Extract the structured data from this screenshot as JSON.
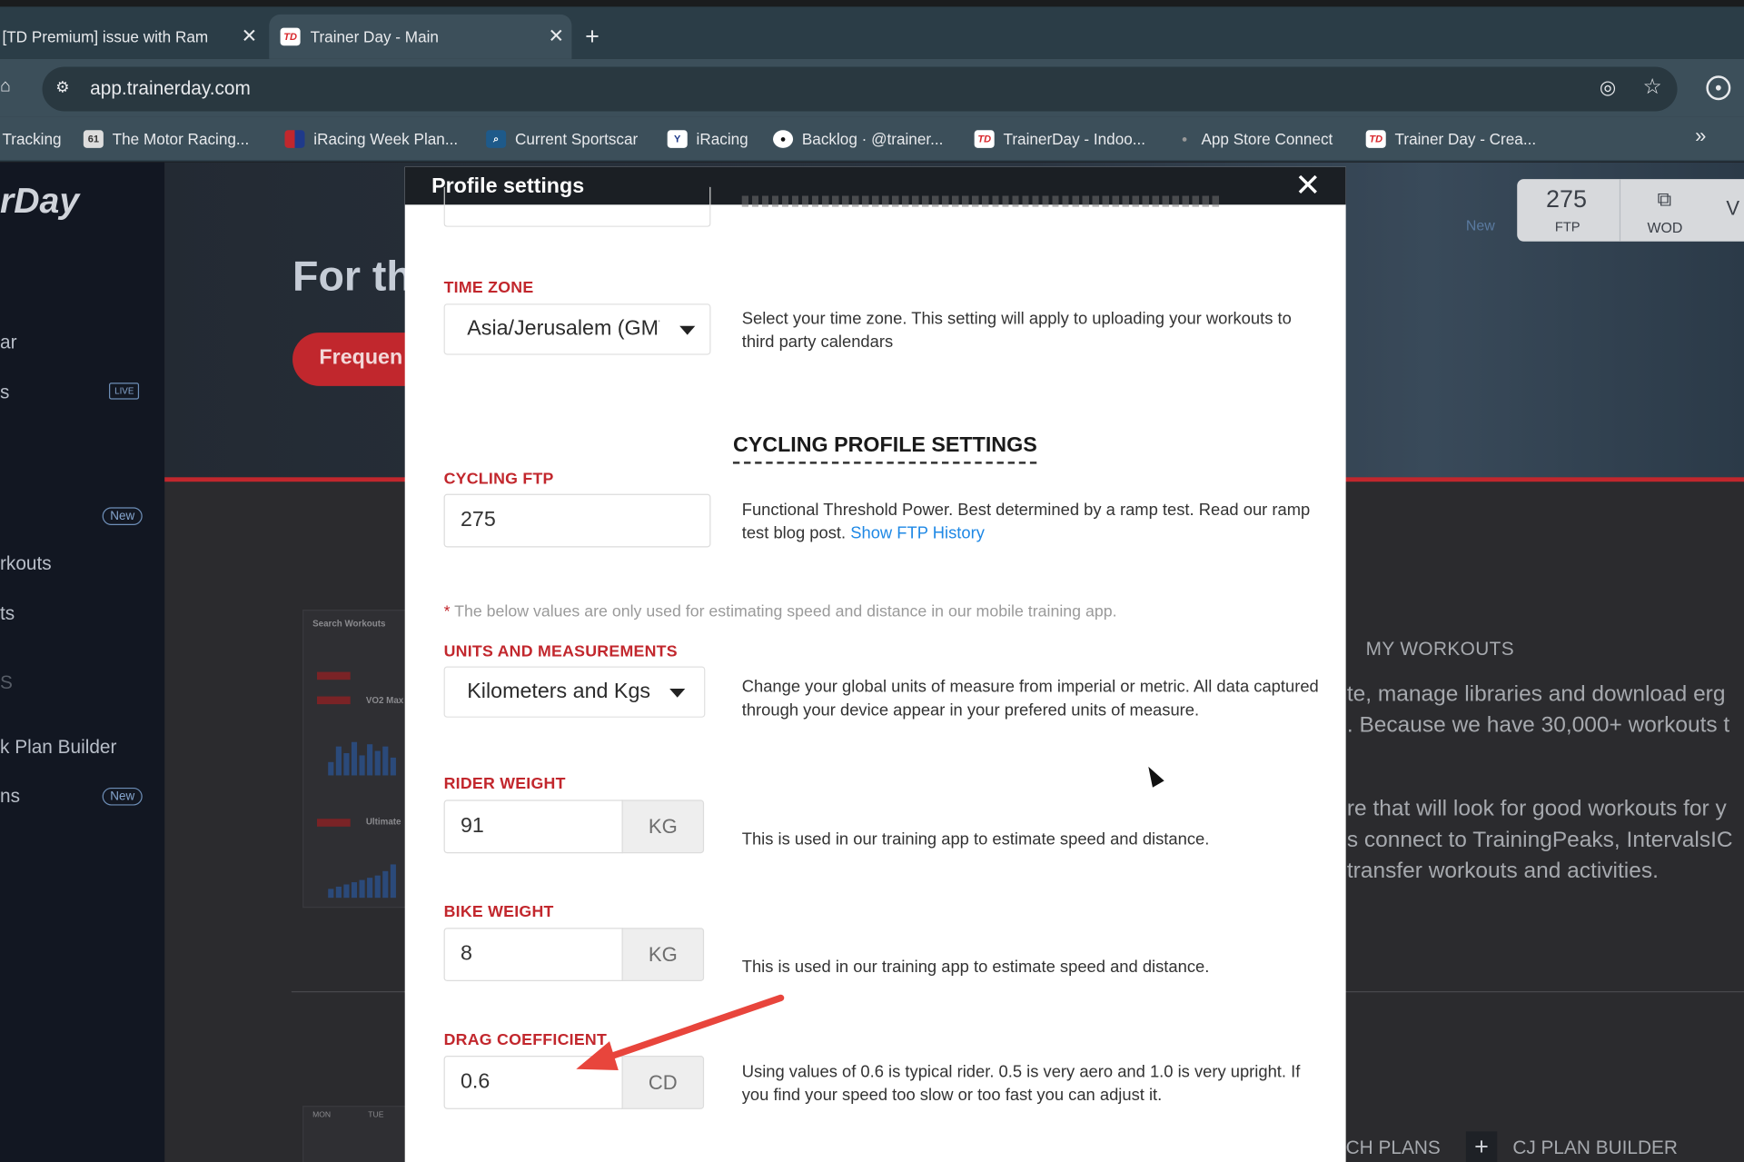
{
  "browser": {
    "tabs": [
      {
        "title": "[TD Premium] issue with Ram",
        "active": false
      },
      {
        "title": "Trainer Day - Main",
        "active": true
      }
    ],
    "favicon_text": "TD",
    "url": "app.trainerday.com",
    "bookmarks": [
      {
        "label": "Tracking",
        "icon": ""
      },
      {
        "label": "The Motor Racing...",
        "icon": "61"
      },
      {
        "label": "iRacing Week Plan...",
        "icon": "flag-icon"
      },
      {
        "label": "Current Sportscar",
        "icon": "search-icon"
      },
      {
        "label": "iRacing",
        "icon": "iracing-icon"
      },
      {
        "label": "Backlog · @trainer...",
        "icon": "github-icon"
      },
      {
        "label": "TrainerDay - Indoo...",
        "icon": "TD"
      },
      {
        "label": "App Store Connect",
        "icon": "apple-icon"
      },
      {
        "label": "Trainer Day - Crea...",
        "icon": "TD"
      }
    ]
  },
  "background": {
    "logo": "rDay",
    "sidebar_items": [
      "ar",
      "s",
      "rkouts",
      "ts",
      "S",
      "k Plan Builder",
      "ns"
    ],
    "badges": {
      "live": "LIVE",
      "new": "New"
    },
    "hero_title": "For th",
    "hero_button": "Frequen",
    "hero_new": "New",
    "ftp_value": "275",
    "ftp_label": "FTP",
    "wod_label": "WOD",
    "va": "V",
    "my_workouts": "MY WORKOUTS",
    "body_lines": [
      "te, manage libraries and download erg",
      ". Because we have 30,000+ workouts t",
      "re that will look for good workouts for y",
      "s connect to TrainingPeaks, IntervalsIC",
      "transfer workouts and activities."
    ],
    "plans_label": "CH PLANS",
    "plus": "+",
    "cj_label": "CJ PLAN BUILDER",
    "thumb": {
      "title": "Search Workouts",
      "w1": "VO2 Max",
      "w2": "Ultimate",
      "cal_mon": "MON",
      "cal_tue": "TUE"
    }
  },
  "modal": {
    "title": "Profile settings",
    "time_zone": {
      "label": "TIME ZONE",
      "value": "Asia/Jerusalem (GMT",
      "desc": "Select your time zone. This setting will apply to uploading your workouts to third party calendars"
    },
    "section_title": "CYCLING PROFILE SETTINGS",
    "cycling_ftp": {
      "label": "CYCLING FTP",
      "value": "275",
      "desc": "Functional Threshold Power. Best determined by a ramp test. Read our ramp test blog post.",
      "link": "Show FTP History"
    },
    "note": {
      "star": "*",
      "text": "The below values are only used for estimating speed and distance in our mobile training app."
    },
    "units": {
      "label": "UNITS AND MEASUREMENTS",
      "value": "Kilometers and Kgs",
      "desc": "Change your global units of measure from imperial or metric. All data captured through your device appear in your prefered units of measure."
    },
    "rider_weight": {
      "label": "RIDER WEIGHT",
      "value": "91",
      "unit": "KG",
      "desc": "This is used in our training app to estimate speed and distance."
    },
    "bike_weight": {
      "label": "BIKE WEIGHT",
      "value": "8",
      "unit": "KG",
      "desc": "This is used in our training app to estimate speed and distance."
    },
    "drag": {
      "label": "DRAG COEFFICIENT",
      "value": "0.6",
      "unit": "CD",
      "desc": "Using values of 0.6 is typical rider. 0.5 is very aero and 1.0 is very upright. If you find your speed too slow or too fast you can adjust it."
    }
  },
  "colors": {
    "accent_red": "#c2272d",
    "link_blue": "#1e88e5",
    "arrow": "#e8453c"
  }
}
